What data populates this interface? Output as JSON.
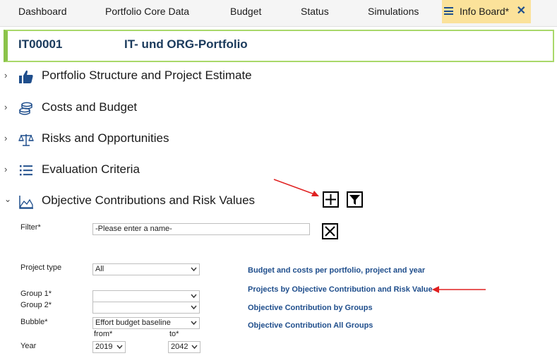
{
  "tabs": {
    "dashboard": "Dashboard",
    "core_data": "Portfolio Core Data",
    "budget": "Budget",
    "status": "Status",
    "simulations": "Simulations",
    "info_board": "Info Board*",
    "close": "✕"
  },
  "header": {
    "code": "IT00001",
    "name": "IT- und ORG-Portfolio"
  },
  "sections": {
    "structure": "Portfolio Structure and Project Estimate",
    "costs": "Costs and Budget",
    "risks": "Risks and Opportunities",
    "criteria": "Evaluation Criteria",
    "objective": "Objective Contributions and Risk Values"
  },
  "form": {
    "filter_label": "Filter*",
    "filter_value": "-Please enter a name-",
    "project_type_label": "Project type",
    "project_type_value": "All",
    "group1_label": "Group 1*",
    "group1_value": "",
    "group2_label": "Group 2*",
    "group2_value": "",
    "bubble_label": "Bubble*",
    "bubble_value": "Effort budget baseline",
    "from_label": "from*",
    "to_label": "to*",
    "year_label": "Year",
    "year_from": "2019",
    "year_to": "2042"
  },
  "reports": {
    "r1": "Budget and costs per portfolio, project and year",
    "r2": "Projects by Objective Contribution and Risk Value",
    "r3": "Objective Contribution by Groups",
    "r4": "Objective Contribution All Groups"
  },
  "colors": {
    "accent_tab": "#fbe29a",
    "header_border": "#8bc34a",
    "link": "#1f4e8c",
    "annotation_arrow": "#e02020"
  }
}
